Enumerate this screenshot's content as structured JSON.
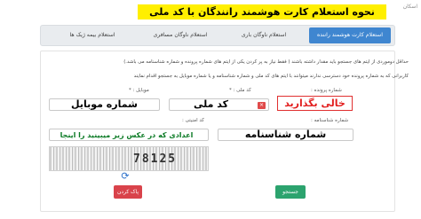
{
  "topbar": {
    "corner_label": "اسکان"
  },
  "headline": "نحوه استعلام کارت هوشمند رانندگان با کد ملی",
  "tabs": [
    {
      "label": "استعلام کارت هوشمند راننده",
      "active": true
    },
    {
      "label": "استعلام ناوگان باری",
      "active": false
    },
    {
      "label": "استعلام ناوگان مسافری",
      "active": false
    },
    {
      "label": "استعلام بیمه ژیک ها",
      "active": false
    }
  ],
  "form": {
    "info_line_1": "حداقل دوموردی از ایتم های جستجو باید مقدار داشته باشند ( فقط نیاز به پر کردن یکی از ایتم های شماره پرونده و شماره شناسنامه می باشد.)",
    "info_line_2": "کاربرانی که به شماره پرونده خود دسترسی ندارند میتوانند با ایتم های کد ملی و شماره شناسنامه و یا شماره موبایل به جستجو اقدام نمایند",
    "case_number_label": "شماره پرونده :",
    "case_number_overlay": "خالی بگذارید",
    "national_code_label": "کد ملی : *",
    "national_code_overlay": "کد ملی",
    "mobile_label": "موبایل : *",
    "mobile_overlay": "شماره موبایل",
    "id_number_label": "شماره شناسنامه :",
    "id_number_overlay": "شماره شناسنامه",
    "security_code_label": "کد امنیتی :",
    "security_code_overlay": "اعدادی که در عکس زیر میبینید را اینجا بنویسید",
    "captcha_value": "78125",
    "clear_button": "پاک کردن",
    "search_button": "جستجو"
  },
  "colors": {
    "headline_bg": "#ffef00",
    "active_tab": "#3f86d0",
    "clear_button": "#d9434b",
    "search_button": "#2ca36e",
    "hint_red": "#e21e1e",
    "hint_green": "#0a7a24"
  },
  "icons": {
    "refresh": "refresh-icon",
    "close": "close-icon"
  }
}
